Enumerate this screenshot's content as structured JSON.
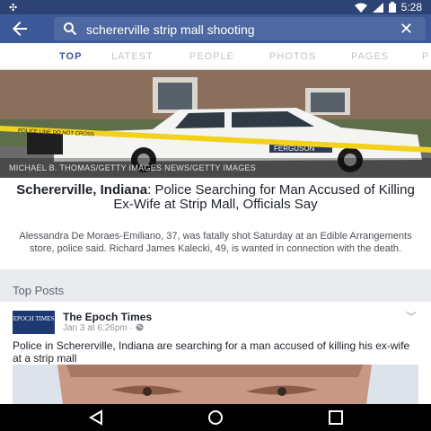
{
  "status_bar": {
    "time": "5:28",
    "icons": [
      "notification-icon",
      "wifi-icon",
      "signal-icon",
      "battery-icon"
    ]
  },
  "search": {
    "query": "schererville strip mall shooting"
  },
  "tabs": [
    {
      "label": "TOP",
      "active": true
    },
    {
      "label": "LATEST",
      "active": false
    },
    {
      "label": "PEOPLE",
      "active": false
    },
    {
      "label": "PHOTOS",
      "active": false
    },
    {
      "label": "PAGES",
      "active": false
    },
    {
      "label": "P",
      "active": false
    }
  ],
  "article": {
    "photo_credit": "MICHAEL B. THOMAS/GETTY IMAGES NEWS/GETTY IMAGES",
    "headline_location": "Schererville, Indiana",
    "headline_rest": ": Police Searching for Man Accused of Killing Ex-Wife at Strip Mall, Officials Say",
    "summary": "Alessandra De Moraes-Emiliano, 37, was fatally shot Saturday at an Edible Arrangements store, police said. Richard James Kalecki, 49, is wanted in connection with the death.",
    "photo_tape_text": "POLICE LINE DO NOT CROSS",
    "photo_car_text": "FERGUSON"
  },
  "top_posts": {
    "title": "Top Posts",
    "post": {
      "logo_text": "EPOCH TIMES",
      "publisher": "The Epoch Times",
      "meta": "Jan 3 at 6:26pm ·",
      "text": "Police in Schererville, Indiana are searching for a man accused of killing his ex-wife at a strip mall"
    }
  },
  "colors": {
    "brand": "#3b5998",
    "status_bar": "#2d4373",
    "search_field": "#4e69a2"
  }
}
